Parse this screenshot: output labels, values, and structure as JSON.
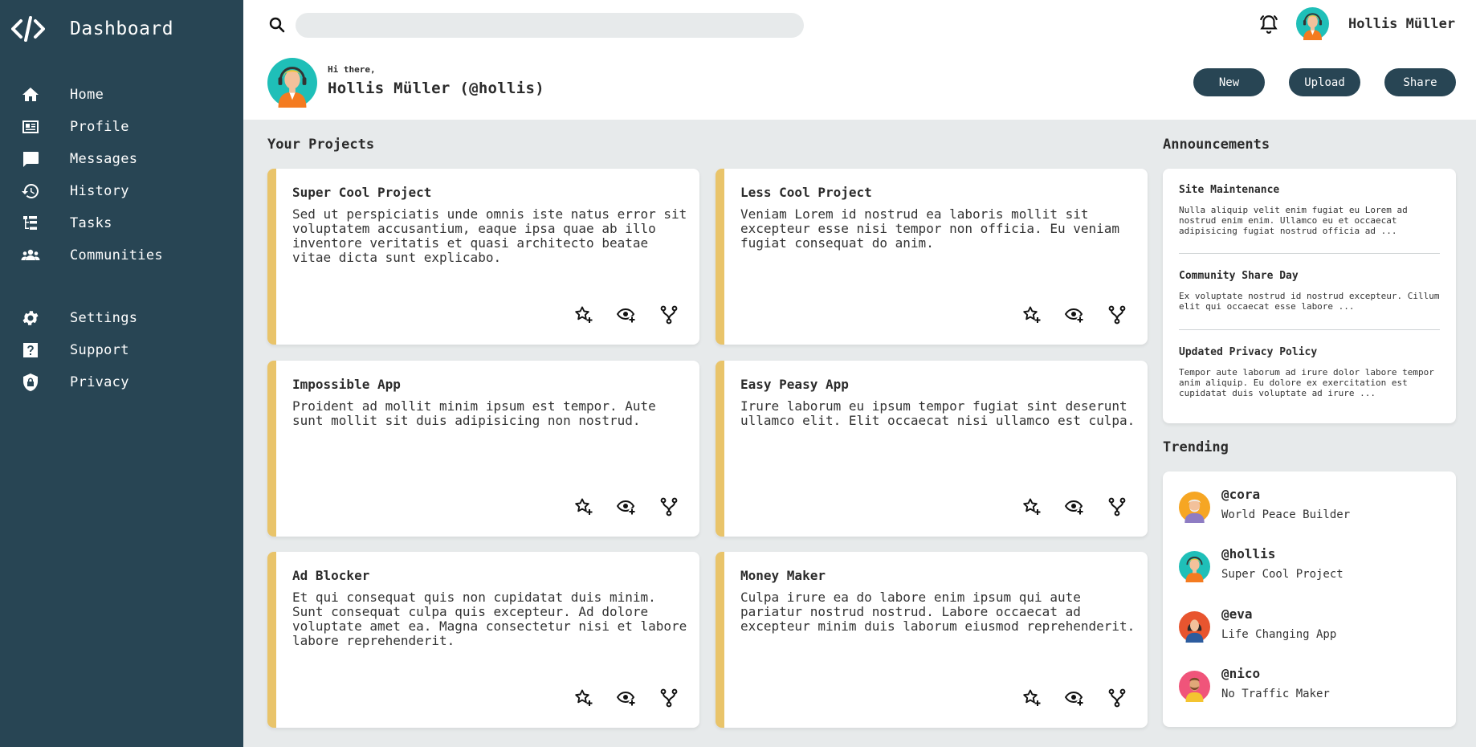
{
  "sidebar": {
    "brand_icon": "code-icon",
    "title": "Dashboard",
    "items": [
      {
        "label": "Home",
        "icon": "home-icon"
      },
      {
        "label": "Profile",
        "icon": "id-card-icon"
      },
      {
        "label": "Messages",
        "icon": "message-icon"
      },
      {
        "label": "History",
        "icon": "history-icon"
      },
      {
        "label": "Tasks",
        "icon": "tasks-icon"
      },
      {
        "label": "Communities",
        "icon": "communities-icon"
      }
    ],
    "secondary_items": [
      {
        "label": "Settings",
        "icon": "gear-icon"
      },
      {
        "label": "Support",
        "icon": "help-icon"
      },
      {
        "label": "Privacy",
        "icon": "shield-lock-icon"
      }
    ],
    "background": "#284554"
  },
  "header": {
    "search_placeholder": "",
    "user_name": "Hollis Müller",
    "greeting": "Hi there,",
    "full_name": "Hollis Müller (@hollis)",
    "buttons": {
      "new": "New",
      "upload": "Upload",
      "share": "Share"
    }
  },
  "projects": {
    "title": "Your Projects",
    "accent": "#e9c46a",
    "items": [
      {
        "title": "Super Cool Project",
        "body": "Sed ut perspiciatis unde omnis iste natus error sit voluptatem accusantium, eaque ipsa quae ab illo inventore veritatis et quasi architecto beatae vitae dicta sunt explicabo."
      },
      {
        "title": "Less Cool Project",
        "body": "Veniam Lorem id nostrud ea laboris mollit sit excepteur esse nisi tempor non officia. Eu veniam fugiat consequat do anim."
      },
      {
        "title": "Impossible App",
        "body": "Proident ad mollit minim ipsum est tempor. Aute sunt mollit sit duis adipisicing non nostrud."
      },
      {
        "title": "Easy Peasy App",
        "body": "Irure laborum eu ipsum tempor fugiat sint deserunt ullamco elit. Elit occaecat nisi ullamco est culpa."
      },
      {
        "title": "Ad Blocker",
        "body": "Et qui consequat quis non cupidatat duis minim. Sunt consequat culpa quis excepteur. Ad dolore voluptate amet ea. Magna consectetur nisi et labore labore reprehenderit."
      },
      {
        "title": "Money Maker",
        "body": "Culpa irure ea do labore enim ipsum qui aute pariatur nostrud nostrud. Labore occaecat ad excepteur minim duis laborum eiusmod reprehenderit."
      }
    ]
  },
  "announcements": {
    "title": "Announcements",
    "items": [
      {
        "title": "Site Maintenance",
        "body": "Nulla aliquip velit enim fugiat eu Lorem ad nostrud enim enim. Ullamco eu et occaecat adipisicing fugiat nostrud officia ad ..."
      },
      {
        "title": "Community Share Day",
        "body": "Ex voluptate nostrud id nostrud excepteur. Cillum elit qui occaecat esse labore ..."
      },
      {
        "title": "Updated Privacy Policy",
        "body": "Tempor aute laborum ad irure dolor labore tempor anim aliquip. Eu dolore ex exercitation est cupidatat duis voluptate ad irure ..."
      }
    ]
  },
  "trending": {
    "title": "Trending",
    "items": [
      {
        "handle": "@cora",
        "desc": "World Peace Builder"
      },
      {
        "handle": "@hollis",
        "desc": "Super Cool Project"
      },
      {
        "handle": "@eva",
        "desc": "Life Changing App"
      },
      {
        "handle": "@nico",
        "desc": "No Traffic Maker"
      }
    ]
  }
}
